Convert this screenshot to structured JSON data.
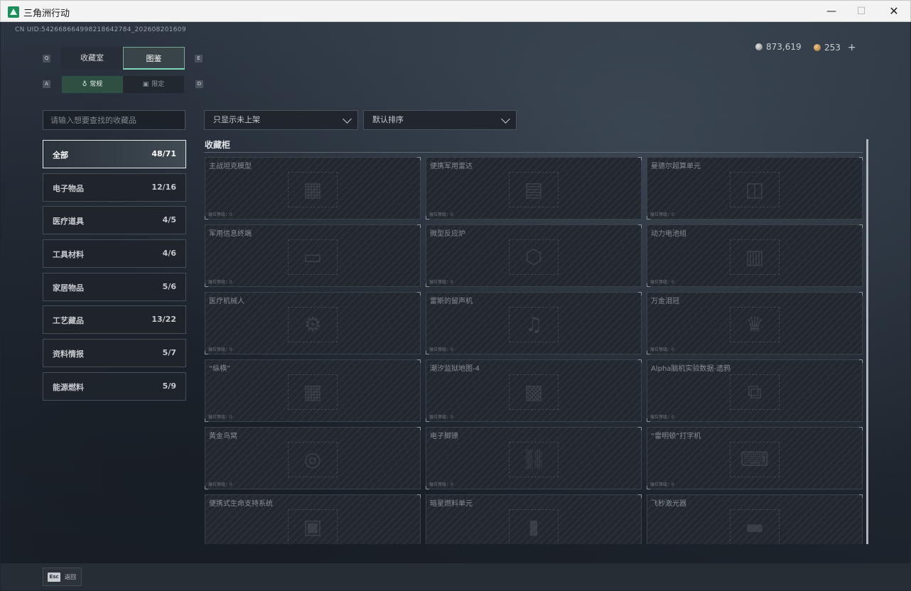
{
  "window": {
    "title": "三角洲行动",
    "min": "—",
    "max": "☐",
    "close": "✕"
  },
  "uid": "CN UID:5426686649982186427​84_202608201609",
  "currency": {
    "silver": "873,619",
    "gold": "253",
    "plus": "+"
  },
  "keys": {
    "tab_left": "Q",
    "tab_right": "E",
    "sub_left": "A",
    "sub_right": "D"
  },
  "tabs": [
    "收藏室",
    "图鉴"
  ],
  "subtabs": [
    {
      "label": "常规",
      "icon": "flask-icon",
      "glyph": "♁"
    },
    {
      "label": "限定",
      "icon": "image-icon",
      "glyph": "▣"
    }
  ],
  "search": {
    "placeholder": "请输入想要查找的收藏品"
  },
  "filters": {
    "status": "只显示未上架",
    "sort": "默认排序"
  },
  "categories": [
    {
      "label": "全部",
      "count": "48/71"
    },
    {
      "label": "电子物品",
      "count": "12/16"
    },
    {
      "label": "医疗道具",
      "count": "4/5"
    },
    {
      "label": "工具材料",
      "count": "4/6"
    },
    {
      "label": "家居物品",
      "count": "5/6"
    },
    {
      "label": "工艺藏品",
      "count": "13/22"
    },
    {
      "label": "资料情报",
      "count": "5/7"
    },
    {
      "label": "能源燃料",
      "count": "5/9"
    }
  ],
  "section_title": "收藏柜",
  "slot_value_label": "展位等级：0",
  "items": [
    {
      "name": "主战坦克模型"
    },
    {
      "name": "便携军用雷达"
    },
    {
      "name": "曼德尔超算单元"
    },
    {
      "name": "军用信息终端"
    },
    {
      "name": "微型反应炉"
    },
    {
      "name": "动力电池组"
    },
    {
      "name": "医疗机械人"
    },
    {
      "name": "雷斯的留声机"
    },
    {
      "name": "万金泪冠"
    },
    {
      "name": "“纵横”"
    },
    {
      "name": "潮汐监狱地图-4"
    },
    {
      "name": "Alpha脑机实验数据-遗鸦"
    },
    {
      "name": "黄金鸟窝"
    },
    {
      "name": "电子脚镣"
    },
    {
      "name": "“雷明顿”打字机"
    },
    {
      "name": "便携式生命支持系统"
    },
    {
      "name": "暗星燃料单元"
    },
    {
      "name": "飞秒激光器"
    }
  ],
  "back": {
    "key": "Esc",
    "label": "返回"
  }
}
